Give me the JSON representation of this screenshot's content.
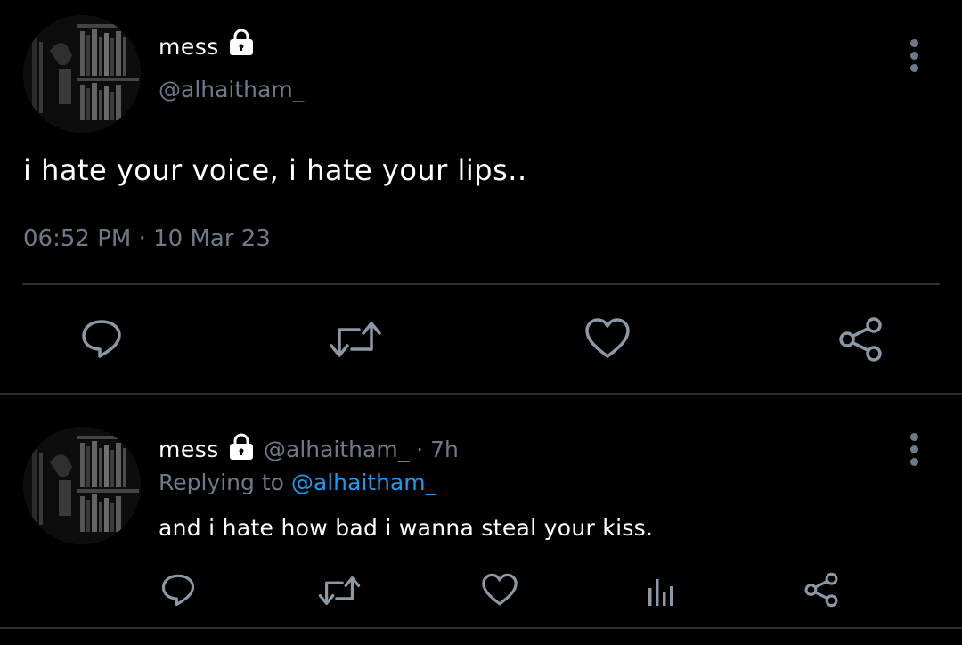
{
  "main_tweet": {
    "display_name": "mess",
    "handle": "@alhaitham_",
    "text": "i hate your voice, i hate your lips..",
    "time": "06:52 PM",
    "separator": "·",
    "date": "10 Mar 23",
    "locked": true
  },
  "reply_tweet": {
    "display_name": "mess",
    "handle": "@alhaitham_",
    "separator": "·",
    "age": "7h",
    "replying_prefix": "Replying to",
    "replying_to": "@alhaitham_",
    "text": "and i hate how bad i wanna steal your kiss.",
    "locked": true
  },
  "icons": {
    "reply": "reply-icon",
    "retweet": "retweet-icon",
    "like": "heart-icon",
    "share": "share-icon",
    "views": "analytics-icon",
    "more": "more-vertical-icon",
    "lock": "lock-icon"
  },
  "colors": {
    "background": "#000000",
    "text": "#ffffff",
    "muted": "#6e7a88",
    "icon": "#8b98a5",
    "link": "#1d9bf0",
    "divider": "#2a2e33"
  }
}
